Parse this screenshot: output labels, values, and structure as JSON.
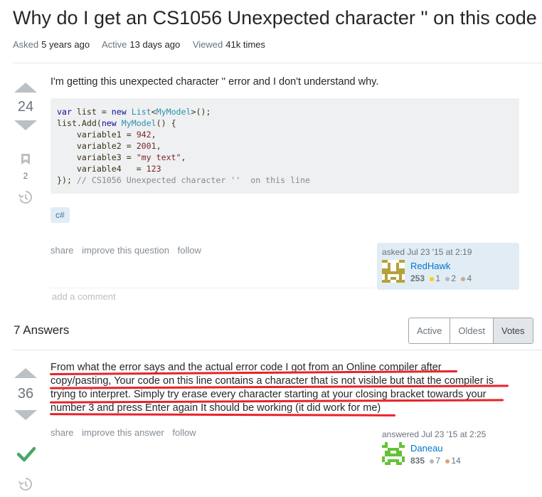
{
  "question": {
    "title": "Why do I get an CS1056 Unexpected character '' on this code",
    "meta": {
      "asked_label": "Asked",
      "asked_value": "5 years ago",
      "active_label": "Active",
      "active_value": "13 days ago",
      "viewed_label": "Viewed",
      "viewed_value": "41k times"
    },
    "votes": "24",
    "bookmarks": "2",
    "body": "I'm getting this unexpected character '' error and I don't understand why.",
    "tag": "c#",
    "menu": {
      "share": "share",
      "improve": "improve this question",
      "follow": "follow"
    },
    "owner": {
      "action": "asked Jul 23 '15 at 2:19",
      "name": "RedHawk",
      "rep": "253",
      "gold": "1",
      "silver": "2",
      "bronze": "4"
    },
    "add_comment": "add a comment"
  },
  "answers_header": {
    "count_label": "7 Answers",
    "tabs": [
      "Active",
      "Oldest",
      "Votes"
    ],
    "selected_tab": "Votes"
  },
  "answer": {
    "votes": "36",
    "accepted": true,
    "lines": [
      "From what the error says and the actual error code I got from an Online compiler after",
      "copy/pasting, Your code on this line contains a character that is not visible but that the compiler is",
      "trying to interpret. Simply try erase every character starting at your closing bracket towards your",
      "number 3 and press Enter again It should be working (it did work for me)"
    ],
    "menu": {
      "share": "share",
      "improve": "improve this answer",
      "follow": "follow"
    },
    "owner": {
      "action": "answered Jul 23 '15 at 2:25",
      "name": "Daneau",
      "rep": "835",
      "silver": "7",
      "bronze": "14"
    }
  },
  "colors": {
    "link": "#0077cc",
    "accepted": "#48a868",
    "highlight": "#e8232a",
    "vote_arrow": "#bbc0c4"
  }
}
